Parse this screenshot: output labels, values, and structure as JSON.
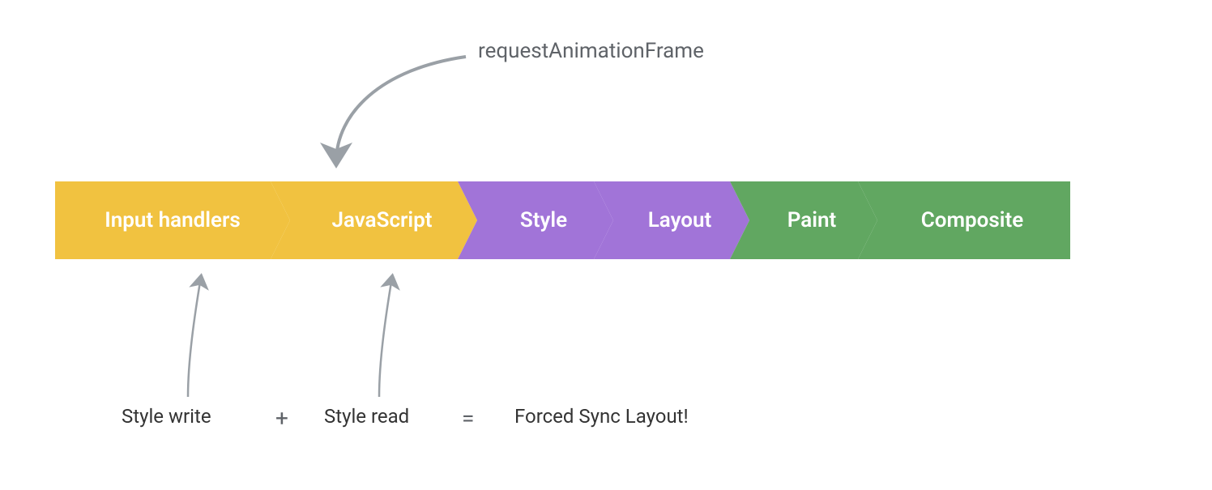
{
  "top_label": "requestAnimationFrame",
  "stages": {
    "input_handlers": "Input handlers",
    "javascript": "JavaScript",
    "style": "Style",
    "layout": "Layout",
    "paint": "Paint",
    "composite": "Composite"
  },
  "bottom": {
    "style_write": "Style write",
    "plus": "+",
    "style_read": "Style read",
    "equals": "=",
    "forced": "Forced Sync Layout!"
  },
  "colors": {
    "yellow": "#f1c240",
    "purple": "#a174d8",
    "green": "#61a761",
    "arrow": "#9aa0a6"
  }
}
